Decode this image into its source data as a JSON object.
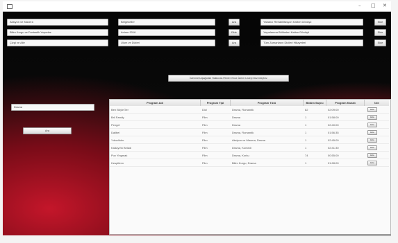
{
  "window": {
    "minimize": "–",
    "maximize": "□",
    "close": "✕"
  },
  "left_column": {
    "fields": [
      "Aksiyon ve Macera",
      "Bilim Kurgu ve Fantastik Yapımlar",
      "Çizgi ve Aile"
    ],
    "search_value": "Drama",
    "ara_button": "Ara"
  },
  "middle_column": {
    "fields": [
      "Belgeseller",
      "Anime 2016",
      "Ulum ve Dizleri"
    ],
    "buttons": [
      "Ara",
      "Ekle",
      "Ara"
    ]
  },
  "right_column": {
    "fields": [
      "Yabancı Rehabilitasyon Kattım Dönüşü",
      "Yayınlanma Bölümleri Kattım Dönüşü",
      "Tüm Zamanların Dizileri Hikayeleri"
    ],
    "buttons": [
      "Ekle",
      "Ekle",
      "Ekle"
    ]
  },
  "center_button": "İstenmeli Aşağıdaki Hakkında Filmler Önce İzlenir Listeyi Düzenleyiniz",
  "table": {
    "headers": [
      "Program Adı",
      "Program Tipi",
      "Program Türü",
      "Bölüm Sayısı",
      "Program Kanalı",
      "İzle"
    ],
    "rows": [
      [
        "Ben Böyle İler",
        "Dizi",
        "Drama, Romantik",
        "82",
        "02:09:00",
        "Ekle"
      ],
      [
        "Bril Family",
        "Film",
        "Drama",
        "1",
        "01:58:00",
        "Ekle"
      ],
      [
        "Pengel",
        "Film",
        "Drama",
        "1",
        "02:40:00",
        "Ekle"
      ],
      [
        "Dalibel",
        "Film",
        "Drama, Romantik",
        "1",
        "01:56:35",
        "Ekle"
      ],
      [
        "Yıkıcılıkler",
        "Film",
        "Aksiyon ve Macera, Drama",
        "1",
        "02:45:00",
        "Ekle"
      ],
      [
        "Kadayıfın Beladı",
        "Film",
        "Drama, Komedi",
        "1",
        "02:41:30",
        "Ekle"
      ],
      [
        "Pux Yingmak",
        "Film",
        "Drama, Korku",
        "74",
        "00:55:00",
        "Ekle"
      ],
      [
        "Hespitiren",
        "Film",
        "Bilim Kurgu, Drama",
        "1",
        "01:28:00",
        "Ekle"
      ]
    ]
  }
}
